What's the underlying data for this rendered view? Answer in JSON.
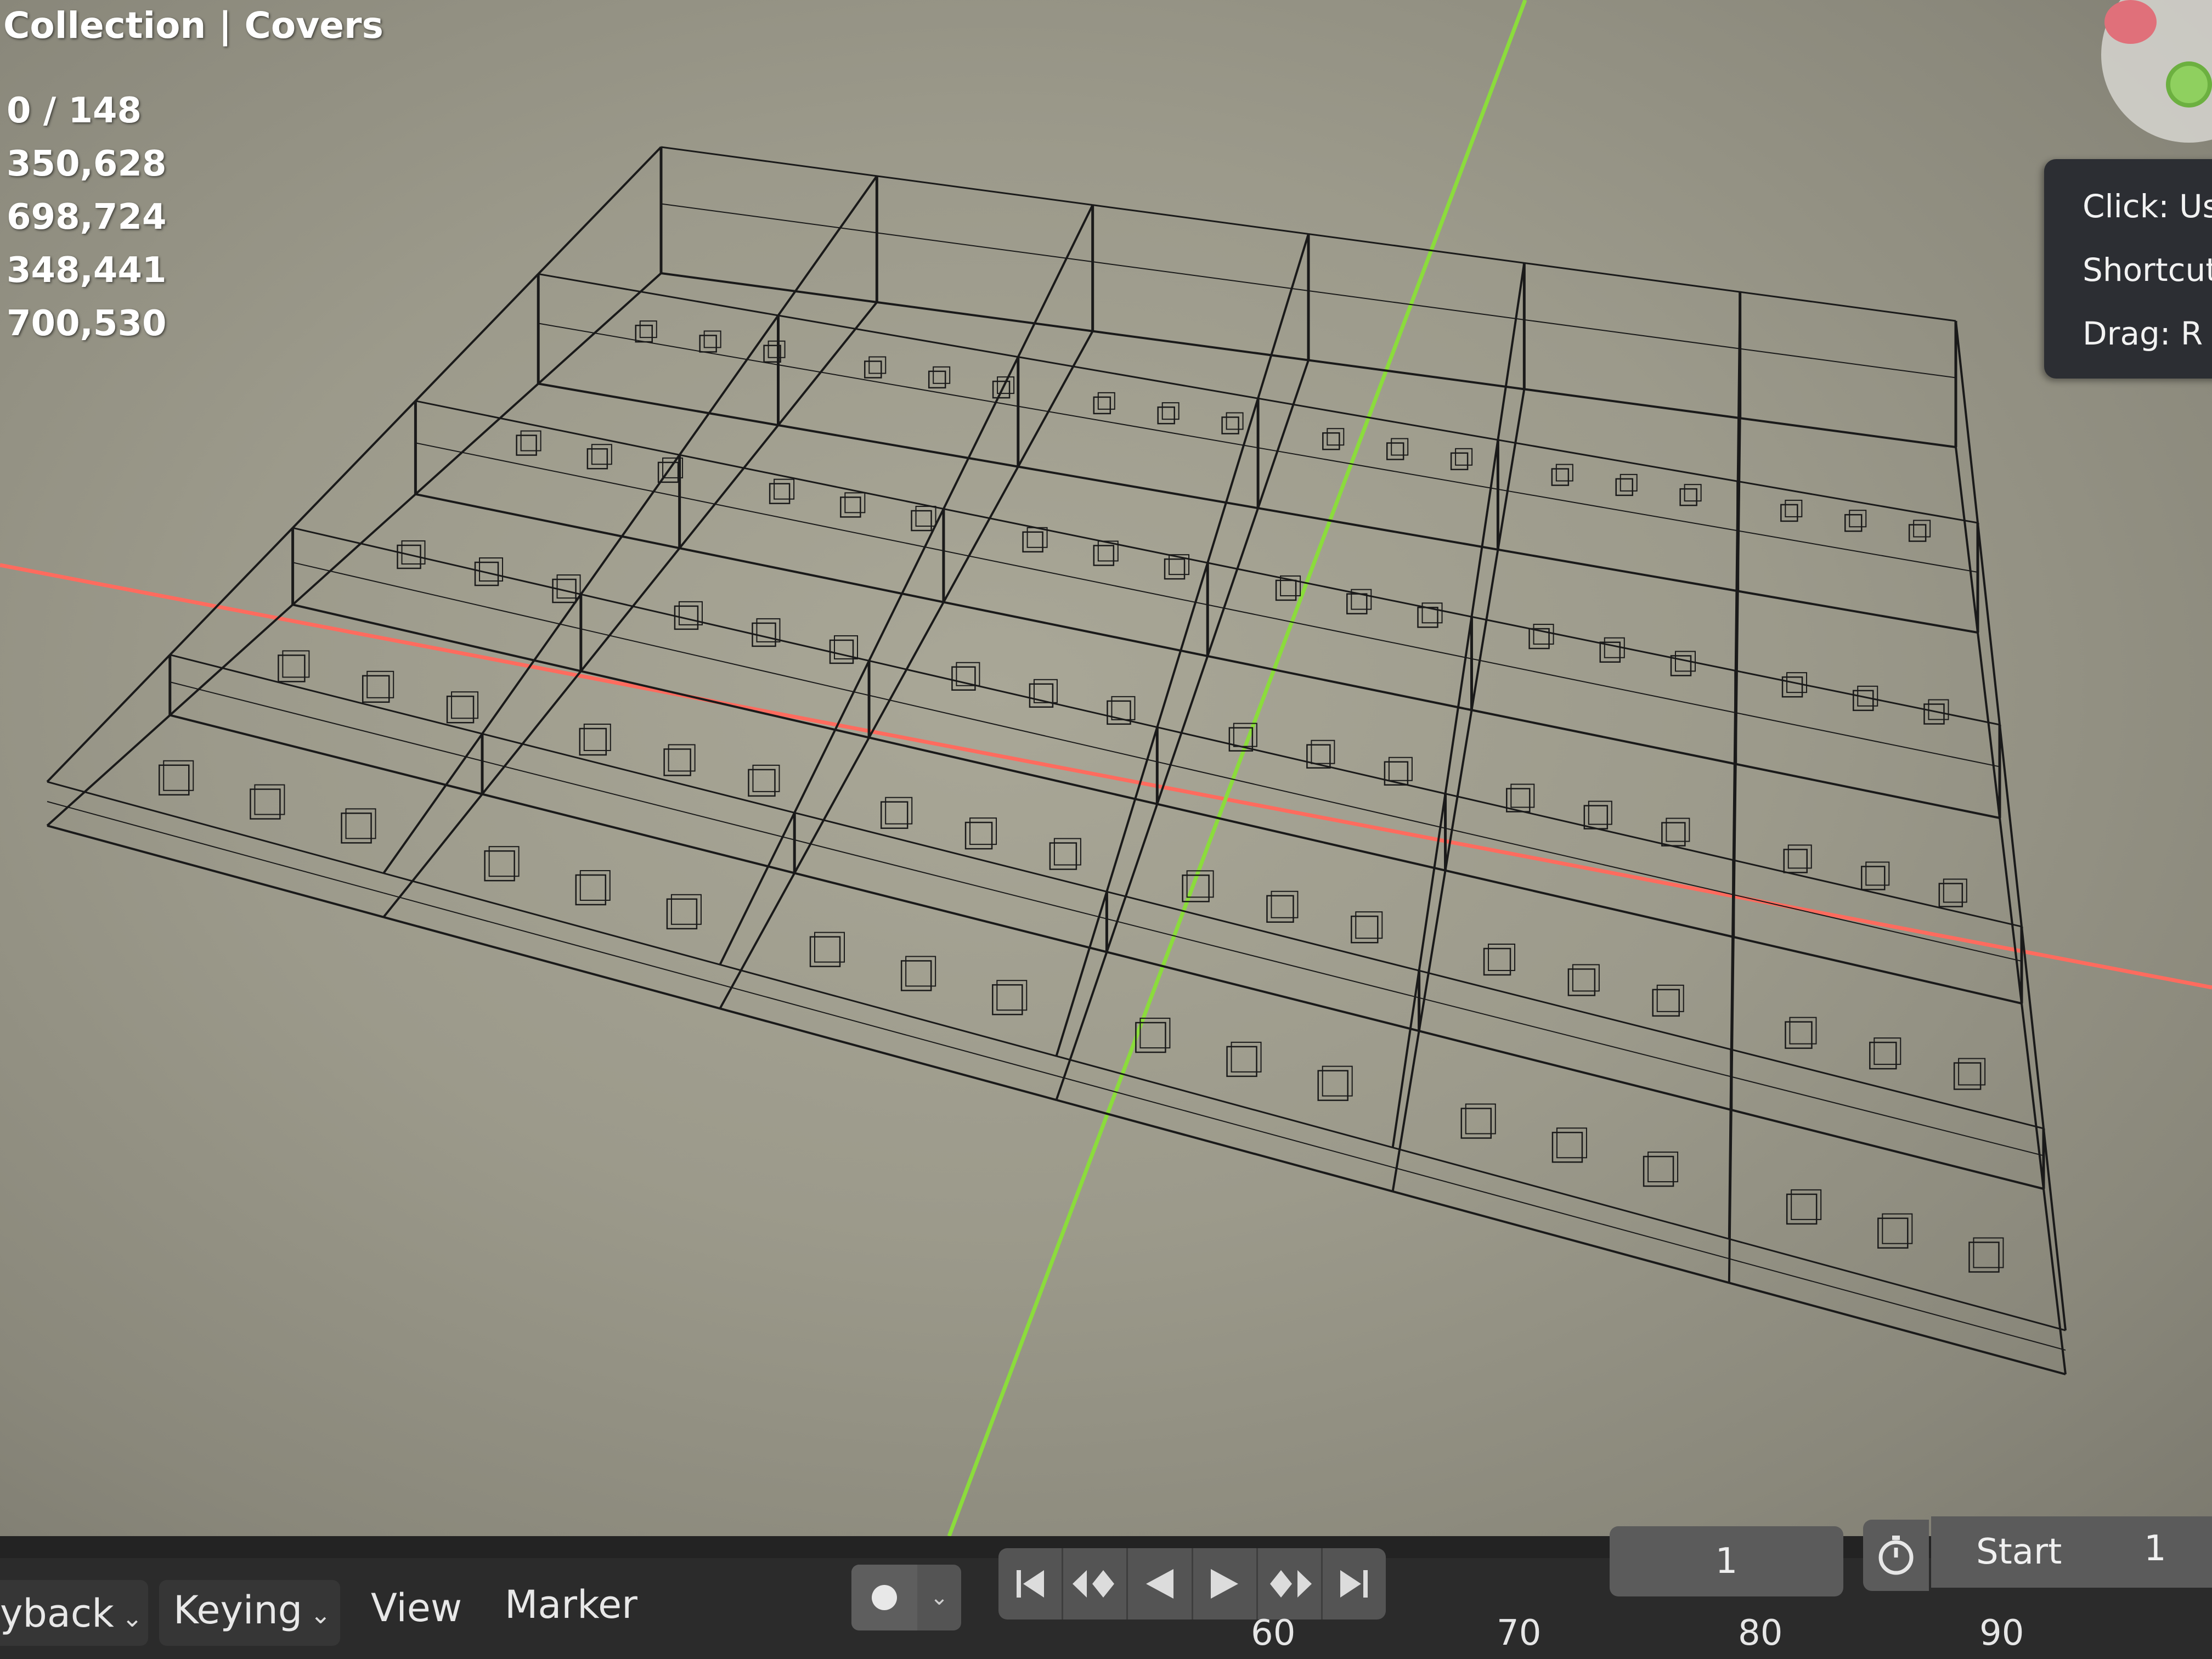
{
  "viewport": {
    "collection_title": "Collection | Covers",
    "stats": [
      "0 / 148",
      "350,628",
      "698,724",
      "348,441",
      "700,530"
    ],
    "background_color": "#9c9a8b",
    "wire_color": "#1a1a1a",
    "x_axis_color": "#ff6b5e",
    "y_axis_color": "#8bdc3c"
  },
  "tooltip": {
    "lines": [
      "Click: Us",
      "Shortcut",
      "Drag: R"
    ]
  },
  "gizmo": {
    "red_icon": "x-axis-handle-icon",
    "green_icon": "y-axis-handle-icon"
  },
  "timeline": {
    "menus": {
      "playback": "yback",
      "keying": "Keying",
      "view": "View",
      "marker": "Marker"
    },
    "current_frame": "1",
    "start_label": "Start",
    "start_value": "1",
    "ruler_ticks": [
      "60",
      "70",
      "80",
      "90"
    ],
    "transport_icons": [
      "jump-to-start-icon",
      "jump-to-keyframe-prev-icon",
      "play-reverse-icon",
      "play-icon",
      "jump-to-keyframe-next-icon",
      "jump-to-end-icon"
    ]
  }
}
